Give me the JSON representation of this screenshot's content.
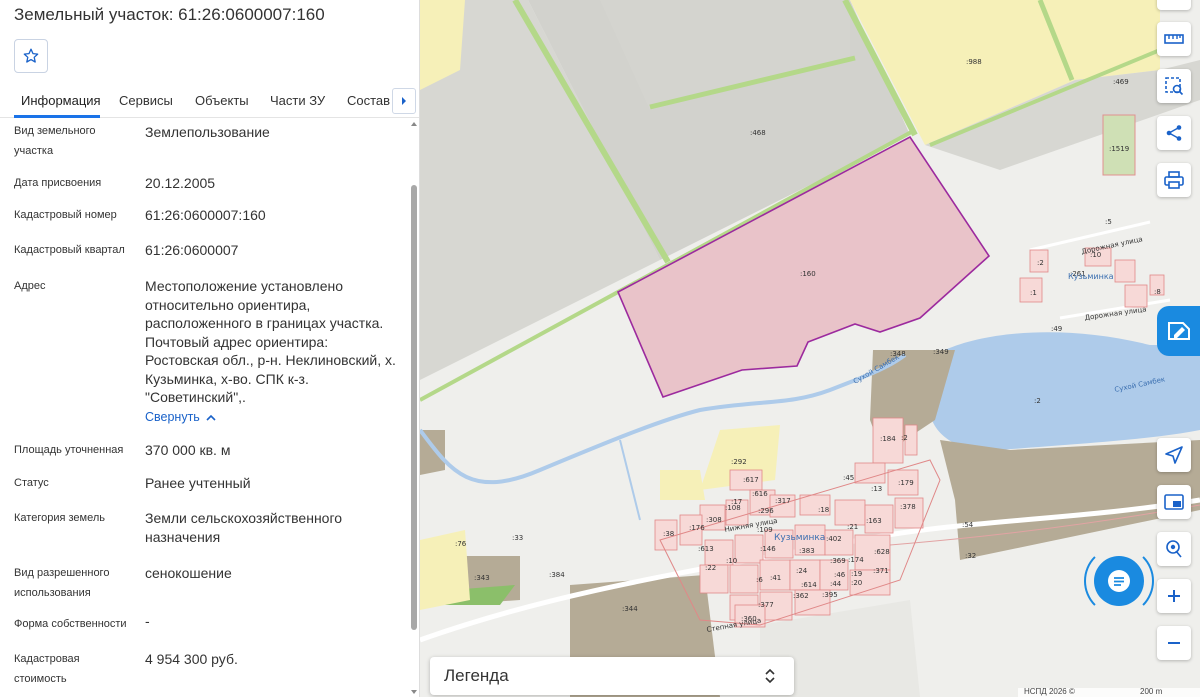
{
  "panel": {
    "title": "Земельный участок: 61:26:0600007:160",
    "tabs": [
      "Информация",
      "Сервисы",
      "Объекты",
      "Части ЗУ",
      "Состав"
    ],
    "rows": [
      {
        "label": "Вид земельного участка",
        "value": "Землепользование"
      },
      {
        "label": "Дата присвоения",
        "value": "20.12.2005"
      },
      {
        "label": "Кадастровый номер",
        "value": "61:26:0600007:160"
      },
      {
        "label": "Кадастровый квартал",
        "value": "61:26:0600007"
      },
      {
        "label": "Адрес",
        "value": "Местоположение установлено относительно ориентира, расположенного в границах участка. Почтовый адрес ориентира: Ростовская обл., р-н. Неклиновский, х. Кузьминка, х-во. СПК к-з. \"Советинский\",."
      },
      {
        "label": "Площадь уточненная",
        "value": "370 000 кв. м"
      },
      {
        "label": "Статус",
        "value": "Ранее учтенный"
      },
      {
        "label": "Категория земель",
        "value": "Земли сельскохозяйственного назначения"
      },
      {
        "label": "Вид разрешенного использования",
        "value": "сенокошение"
      },
      {
        "label": "Форма собственности",
        "value": "-"
      },
      {
        "label": "Кадастровая стоимость",
        "value": "4 954 300 руб."
      }
    ],
    "collapse_label": "Свернуть"
  },
  "map": {
    "legend_label": "Легенда",
    "attribution": "НСПД 2026 ©",
    "scale_label": "200 m",
    "labels": {
      "p468": ":468",
      "p988": ":988",
      "p469": ":469",
      "p1519": ":1519",
      "p160": ":160",
      "p5": ":5",
      "p10": ":10",
      "p261": ":261",
      "p2a": ":2",
      "p1": ":1",
      "p8": ":8",
      "p49": ":49",
      "p348": ":348",
      "p349": ":349",
      "p2lake": ":2",
      "p184": ":184",
      "p2b": ":2",
      "p292": ":292",
      "p617": ":617",
      "p616": ":616",
      "p45": ":45",
      "p13": ":13",
      "p179": ":179",
      "p108": ":108",
      "p17": ":17",
      "p317": ":317",
      "p296": ":296",
      "p18": ":18",
      "p378": ":378",
      "p308": ":308",
      "p176": ":176",
      "p109": ":109",
      "p21": ":21",
      "p163": ":163",
      "p38": ":38",
      "p613": ":613",
      "p146": ":146",
      "p402": ":402",
      "p628": ":628",
      "p10b": ":10",
      "p22": ":22",
      "p371": ":371",
      "p383": ":383",
      "p369": ":369",
      "p174": ":174",
      "p614": ":614",
      "p46": ":46",
      "p19": ":19",
      "p24": ":24",
      "p44": ":44",
      "p20": ":20",
      "p362": ":362",
      "p395": ":395",
      "p377": ":377",
      "p360": ":360",
      "p76": ":76",
      "p33": ":33",
      "p343": ":343",
      "p384": ":384",
      "p344": ":344",
      "p54": ":54",
      "p32": ":32",
      "p41": ":41",
      "p6": ":6",
      "street1": "Дорожная улица",
      "street2": "Дорожная улица",
      "village": "Кузьминка",
      "river1": "Сухой Самбек",
      "river2": "Сухой Самбек",
      "village2": "Кузьминка",
      "street3": "Нижняя улица",
      "street4": "Степная улица"
    }
  },
  "colors": {
    "accent": "#1a73e8",
    "parcel_fill": "#e9c3c9",
    "parcel_stroke": "#9c2a9e",
    "field_gray": "#d7d7d2",
    "field_yellow": "#f6f0b8",
    "water": "#aecbea",
    "built_brown": "#b5ab96",
    "green_strip": "#b4d889"
  },
  "icons": [
    "star-icon",
    "chevron-right-icon",
    "chevron-up-icon",
    "ruler-icon",
    "select-area-icon",
    "share-icon",
    "print-icon",
    "locate-icon",
    "basemap-icon",
    "geolocation-icon",
    "zoom-in-icon",
    "zoom-out-icon",
    "chat-icon",
    "sort-icon"
  ]
}
